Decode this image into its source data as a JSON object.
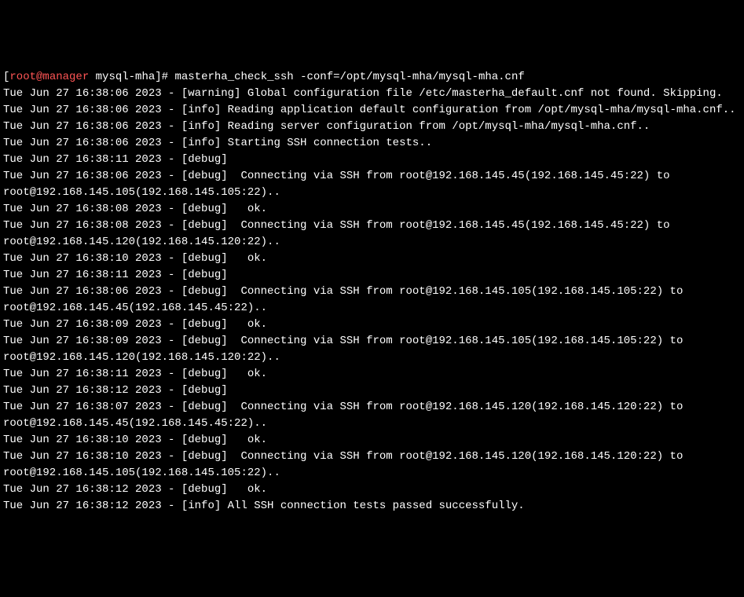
{
  "prompt": {
    "open_bracket": "[",
    "user_host": "root@manager",
    "space": " ",
    "path": "mysql-mha",
    "close_bracket": "]#",
    "command": " masterha_check_ssh -conf=/opt/mysql-mha/mysql-mha.cnf"
  },
  "lines": [
    "Tue Jun 27 16:38:06 2023 - [warning] Global configuration file /etc/masterha_default.cnf not found. Skipping.",
    "Tue Jun 27 16:38:06 2023 - [info] Reading application default configuration from /opt/mysql-mha/mysql-mha.cnf..",
    "Tue Jun 27 16:38:06 2023 - [info] Reading server configuration from /opt/mysql-mha/mysql-mha.cnf..",
    "Tue Jun 27 16:38:06 2023 - [info] Starting SSH connection tests..",
    "Tue Jun 27 16:38:11 2023 - [debug] ",
    "Tue Jun 27 16:38:06 2023 - [debug]  Connecting via SSH from root@192.168.145.45(192.168.145.45:22) to root@192.168.145.105(192.168.145.105:22)..",
    "Tue Jun 27 16:38:08 2023 - [debug]   ok.",
    "Tue Jun 27 16:38:08 2023 - [debug]  Connecting via SSH from root@192.168.145.45(192.168.145.45:22) to root@192.168.145.120(192.168.145.120:22)..",
    "Tue Jun 27 16:38:10 2023 - [debug]   ok.",
    "Tue Jun 27 16:38:11 2023 - [debug] ",
    "Tue Jun 27 16:38:06 2023 - [debug]  Connecting via SSH from root@192.168.145.105(192.168.145.105:22) to root@192.168.145.45(192.168.145.45:22)..",
    "Tue Jun 27 16:38:09 2023 - [debug]   ok.",
    "Tue Jun 27 16:38:09 2023 - [debug]  Connecting via SSH from root@192.168.145.105(192.168.145.105:22) to root@192.168.145.120(192.168.145.120:22)..",
    "Tue Jun 27 16:38:11 2023 - [debug]   ok.",
    "Tue Jun 27 16:38:12 2023 - [debug] ",
    "Tue Jun 27 16:38:07 2023 - [debug]  Connecting via SSH from root@192.168.145.120(192.168.145.120:22) to root@192.168.145.45(192.168.145.45:22)..",
    "Tue Jun 27 16:38:10 2023 - [debug]   ok.",
    "Tue Jun 27 16:38:10 2023 - [debug]  Connecting via SSH from root@192.168.145.120(192.168.145.120:22) to root@192.168.145.105(192.168.145.105:22)..",
    "Tue Jun 27 16:38:12 2023 - [debug]   ok.",
    "Tue Jun 27 16:38:12 2023 - [info] All SSH connection tests passed successfully."
  ]
}
